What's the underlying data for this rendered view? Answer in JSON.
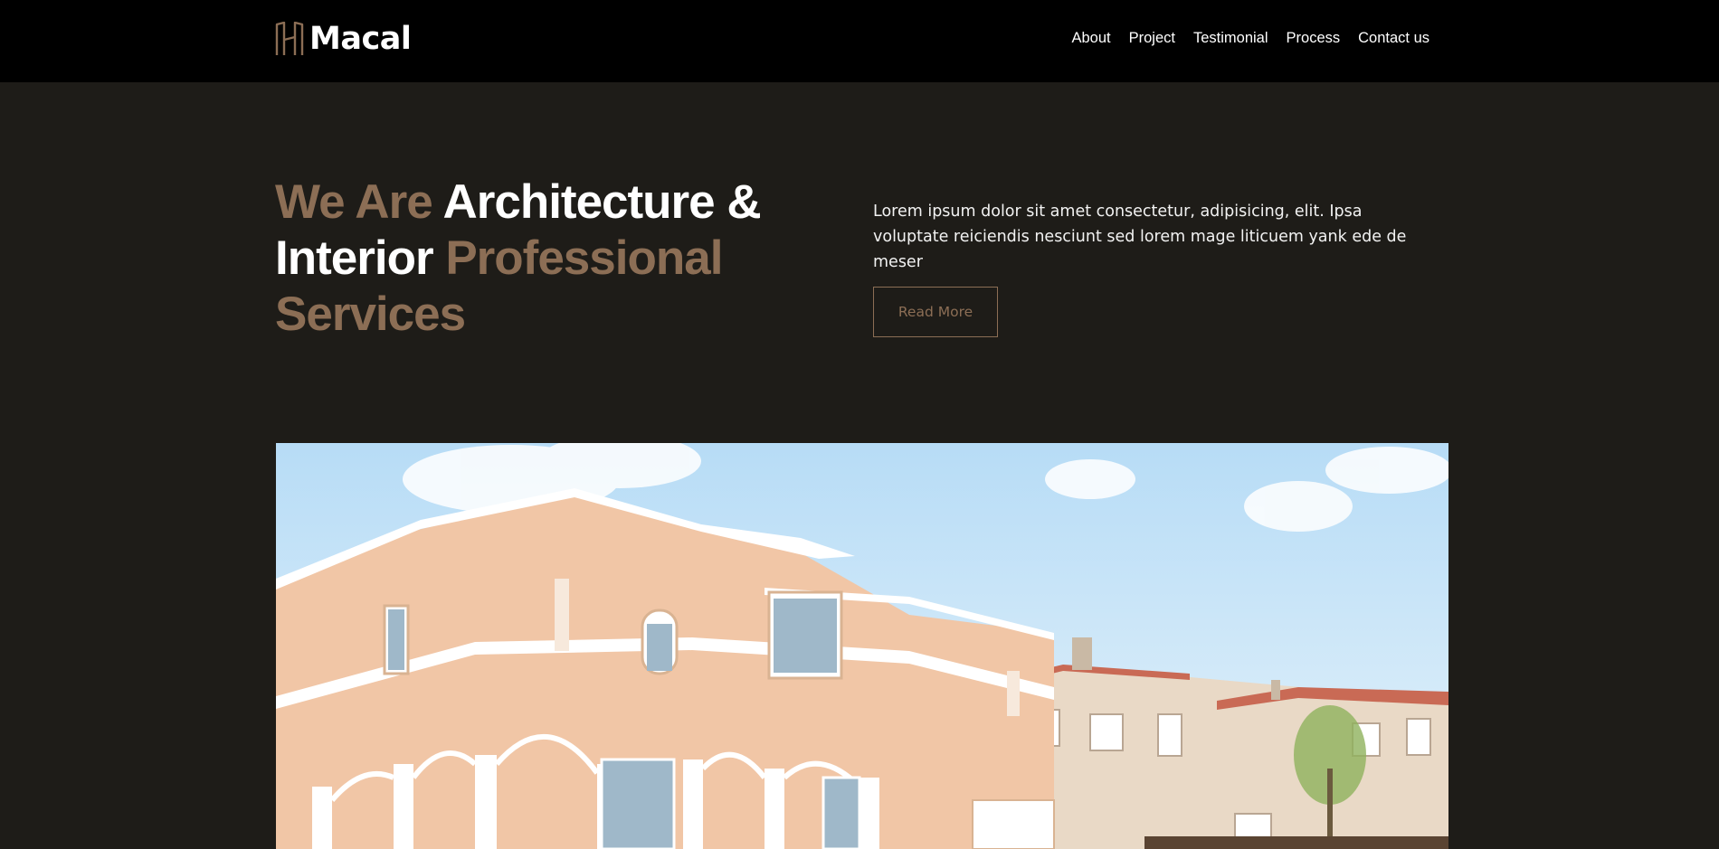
{
  "brand": {
    "name": "Macal",
    "logo_icon": "building-h-icon",
    "accent_color": "#8c6e55"
  },
  "nav": {
    "items": [
      {
        "label": "About"
      },
      {
        "label": "Project"
      },
      {
        "label": "Testimonial"
      },
      {
        "label": "Process"
      },
      {
        "label": "Contact us"
      }
    ]
  },
  "hero": {
    "title_part1": "We Are",
    "title_part2": "Architecture &",
    "title_part3": "Interior",
    "title_part4": "Professional",
    "title_part5": "Services",
    "description": "Lorem ipsum dolor sit amet consectetur, adipisicing, elit. Ipsa voluptate reiciendis nesciunt sed lorem mage liticuem yank ede de meser",
    "button_label": "Read More"
  },
  "colors": {
    "navbar_bg": "#000000",
    "page_bg": "#1e1c18",
    "muted_title": "#8c6e55"
  }
}
